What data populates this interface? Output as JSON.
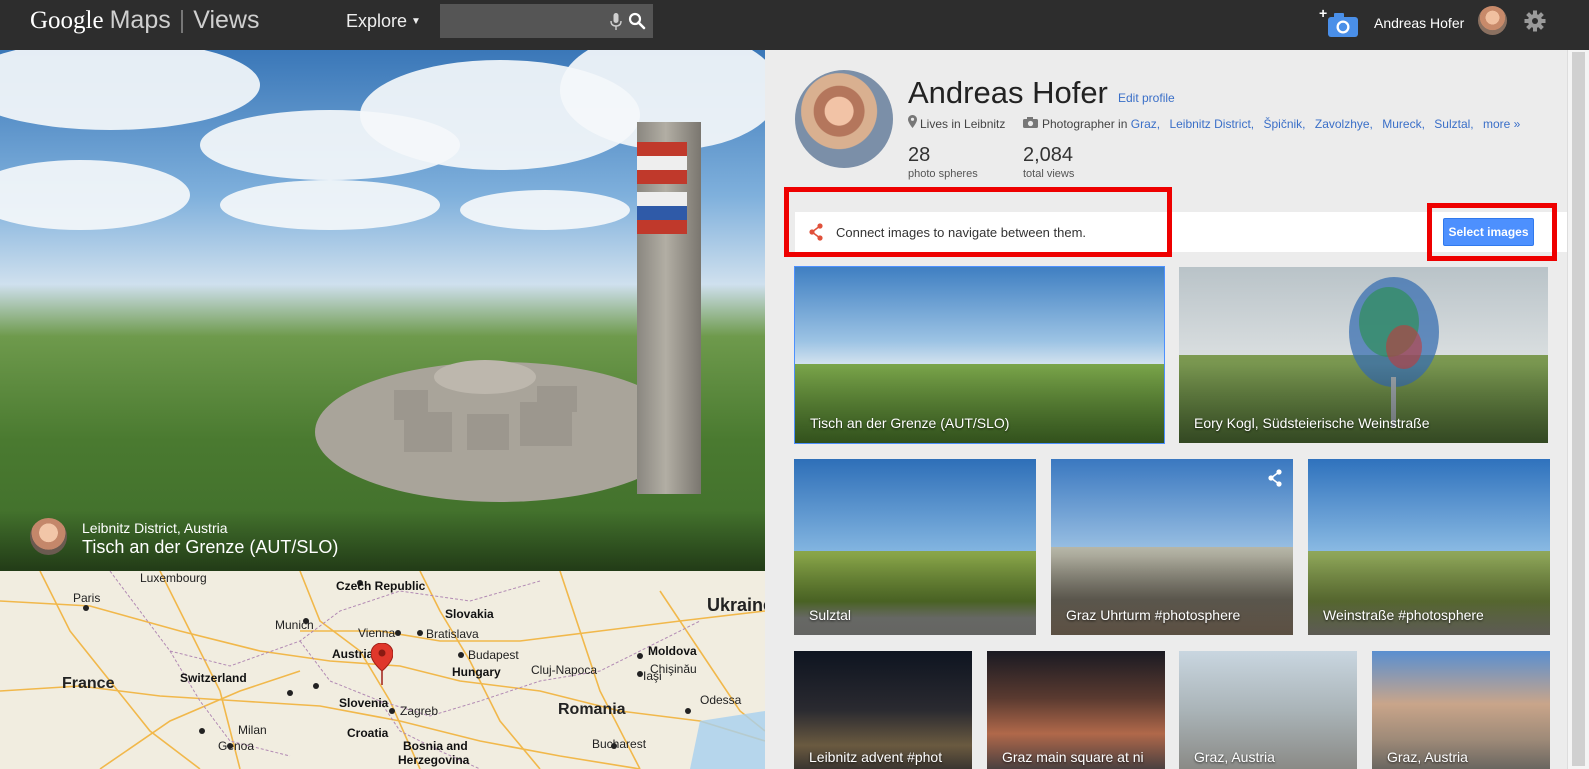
{
  "header": {
    "logo_google": "Google",
    "logo_maps": "Maps",
    "logo_views": "Views",
    "explore_label": "Explore",
    "search_placeholder": "",
    "user_name": "Andreas Hofer"
  },
  "panorama": {
    "location": "Leibnitz District, Austria",
    "title": "Tisch an der Grenze (AUT/SLO)"
  },
  "map": {
    "labels": {
      "luxembourg": "Luxembourg",
      "czech": "Czech Republic",
      "ukraine": "Ukraine",
      "paris": "Paris",
      "slovakia": "Slovakia",
      "munich": "Munich",
      "vienna": "Vienna",
      "bratislava": "Bratislava",
      "moldova": "Moldova",
      "austria": "Austria",
      "budapest": "Budapest",
      "chisinau": "Chişinău",
      "france": "France",
      "switzerland": "Switzerland",
      "hungary": "Hungary",
      "cluj": "Cluj-Napoca",
      "iasi": "Iaşi",
      "slovenia": "Slovenia",
      "zagreb": "Zagreb",
      "odessa": "Odessa",
      "romania": "Romania",
      "croatia": "Croatia",
      "milan": "Milan",
      "genoa": "Genoa",
      "bosnia": "Bosnia and",
      "herzegovina": "Herzegovina",
      "bucharest": "Bucharest"
    }
  },
  "profile": {
    "name": "Andreas Hofer",
    "edit_label": "Edit profile",
    "lives_in": "Lives in Leibnitz",
    "photographer_prefix": "Photographer in",
    "places": [
      "Graz,",
      "Leibnitz District,",
      "Špičnik,",
      "Zavolzhye,",
      "Mureck,",
      "Sulztal,",
      "more »"
    ],
    "spheres_count": "28",
    "spheres_label": "photo spheres",
    "views_count": "2,084",
    "views_label": "total views"
  },
  "connect": {
    "text": "Connect images to navigate between them.",
    "button": "Select images"
  },
  "tiles": [
    {
      "label": "Tisch an der Grenze (AUT/SLO)"
    },
    {
      "label": "Eory Kogl, Südsteierische Weinstraße"
    },
    {
      "label": "Sulztal"
    },
    {
      "label": "Graz Uhrturm #photosphere"
    },
    {
      "label": "Weinstraße #photosphere"
    },
    {
      "label": "Leibnitz advent #phot"
    },
    {
      "label": "Graz main square at ni"
    },
    {
      "label": "Graz, Austria"
    },
    {
      "label": "Graz, Austria"
    }
  ],
  "colors": {
    "topbar": "#2d2d2d",
    "accent_blue": "#4d90fe",
    "link_blue": "#3a6fc8",
    "highlight_red": "#e00000",
    "map_pin": "#e0372b"
  }
}
